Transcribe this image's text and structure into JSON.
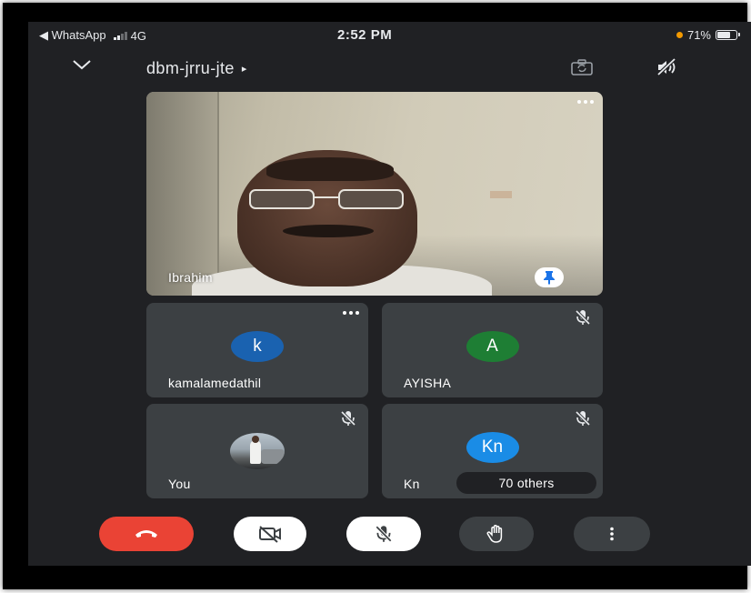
{
  "status_bar": {
    "back_app": "◀ WhatsApp",
    "network": "4G",
    "time": "2:52 PM",
    "battery": "71%",
    "battery_level": 0.71
  },
  "header": {
    "meeting_code": "dbm-jrru-jte",
    "arrow": "▸"
  },
  "main_participant": {
    "name": "Ibrahim"
  },
  "participants": [
    {
      "name": "kamalamedathil",
      "initial": "k",
      "color": "#1a62b0"
    },
    {
      "name": "AYISHA",
      "initial": "A",
      "color": "#1e7e34"
    },
    {
      "name": "You"
    },
    {
      "name": "Kn",
      "initial": "Kn",
      "color": "#1a8ce6"
    }
  ],
  "others_label": "70 others",
  "colors": {
    "background": "#202124",
    "tile": "#3c4043",
    "end_call": "#ea4335"
  }
}
